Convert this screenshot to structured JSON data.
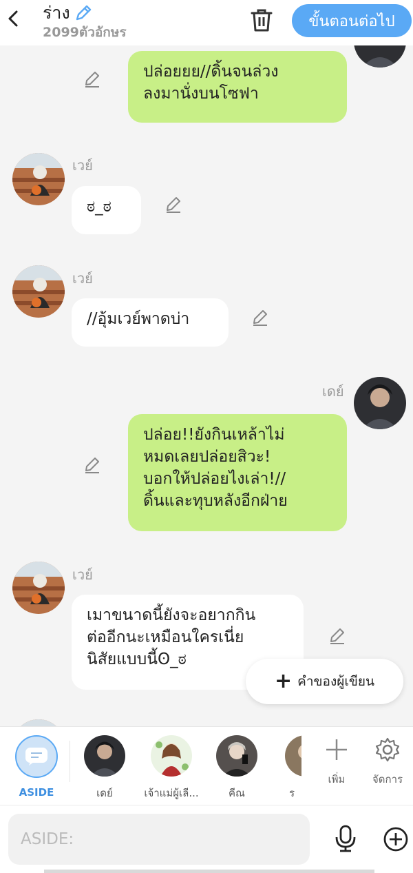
{
  "header": {
    "title": "ร่าง",
    "char_count": "2099ตัวอักษร",
    "next_label": "ขั้นตอนต่อไป"
  },
  "messages": [
    {
      "side": "right",
      "sender": "",
      "text": "ปล่อยยย//ดิ้นจนล่วง\nลงมานั่งบนโซฟา"
    },
    {
      "side": "left",
      "sender": "เวย์",
      "text": "ಠ_ಠ"
    },
    {
      "side": "left",
      "sender": "เวย์",
      "text": "//อุ้มเวย์พาดบ่า"
    },
    {
      "side": "right",
      "sender": "เดย์",
      "text": "ปล่อย!!ยังกินเหล้าไม่\nหมดเลยปล่อยสิวะ!\nบอกให้ปล่อยไงเล่า!//\nดิ้นและทุบหลังอีกฝ่าย"
    },
    {
      "side": "left",
      "sender": "เวย์",
      "text": "เมาขนาดนี้ยังจะอยากกิน\nต่ออีกนะเหมือนใครเนี่ย\nนิสัยแบบนี้ʘ_ಠ"
    }
  ],
  "fab": {
    "label": "คำของผู้เขียน"
  },
  "characters": [
    {
      "label": "ASIDE"
    },
    {
      "label": "เดย์"
    },
    {
      "label": "เจ้าแม่ผู้เลี..."
    },
    {
      "label": "คีณ"
    },
    {
      "label": "ร"
    }
  ],
  "tools": {
    "add_label": "เพิ่ม",
    "manage_label": "จัดการ"
  },
  "input": {
    "placeholder": "ASIDE:"
  },
  "colors": {
    "accent": "#5aa9f5",
    "bubble_right": "#c8ef87",
    "bubble_left": "#ffffff"
  }
}
